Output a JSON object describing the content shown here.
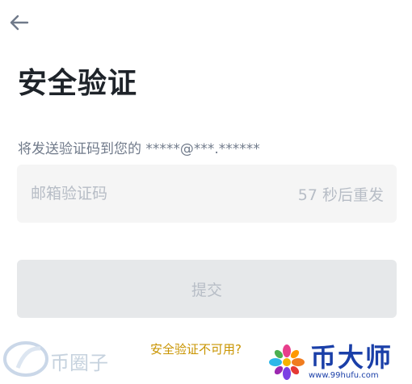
{
  "header": {
    "back_icon": "arrow-left-icon",
    "title": "安全验证"
  },
  "verification": {
    "hint": "将发送验证码到您的 *****@***.******",
    "code_placeholder": "邮箱验证码",
    "resend_countdown": "57 秒后重发"
  },
  "actions": {
    "submit_label": "提交",
    "unavailable_link": "安全验证不可用?"
  },
  "watermarks": {
    "left_text": "币圈子",
    "right_title": "币大师",
    "right_url": "www.99hufu.com"
  },
  "colors": {
    "text_primary": "#1e2329",
    "text_secondary": "#707a8a",
    "placeholder": "#b7bdc6",
    "field_bg": "#f5f5f5",
    "button_disabled_bg": "#e6e8ea",
    "link_accent": "#c99400",
    "watermark_blue": "#1a3fa8"
  }
}
